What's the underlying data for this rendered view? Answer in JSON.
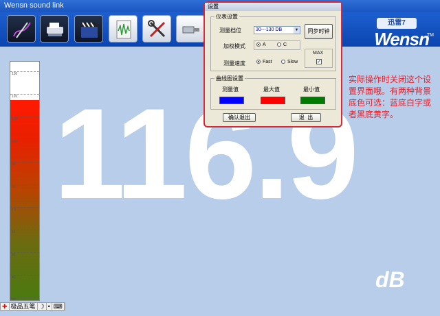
{
  "window": {
    "title": "Wensn sound link"
  },
  "toolbar": {
    "buttons": [
      {
        "icon": "graph-pen-icon"
      },
      {
        "icon": "scanner-icon"
      },
      {
        "icon": "clapperboard-icon"
      },
      {
        "icon": "waveform-document-icon"
      },
      {
        "icon": "tools-icon"
      },
      {
        "icon": "usb-cable-icon"
      }
    ]
  },
  "brand": {
    "badge": "迅雷7",
    "logo": "Wensn",
    "trademark": "TM"
  },
  "meter": {
    "level_percent": 84,
    "tick_labels": [
      "130",
      "120",
      "110",
      "100",
      "90",
      "80",
      "70",
      "60",
      "50",
      "40",
      "30"
    ]
  },
  "reading": {
    "value": "116.9",
    "unit": "dB"
  },
  "note": {
    "text": "实际操作时关闭这个设置界面哦。有两种背景底色可选：蓝底白字或者黑底黄字。"
  },
  "dialog": {
    "title": "设置",
    "meter_group": {
      "label": "仪表设置",
      "range_label": "测量档位",
      "range_value": "30---130 DB",
      "weighting_label": "加权模式",
      "weighting_options": [
        "A",
        "C"
      ],
      "weighting_selected": "A",
      "speed_label": "测量速度",
      "speed_options": [
        "Fast",
        "Slow"
      ],
      "speed_selected": "Fast",
      "sync_button": "同步时钟",
      "max_label": "MAX",
      "max_checked": true
    },
    "curve_group": {
      "label": "曲线图设置",
      "measured_label": "测量值",
      "max_label": "最大值",
      "min_label": "最小值",
      "measured_color": "#0000ff",
      "max_color": "#ff0000",
      "min_color": "#007a00"
    },
    "confirm_button": "确认退出",
    "exit_button": "退  出"
  },
  "ime": {
    "mode": "极品五笔",
    "moon": "☽",
    "dot": "•",
    "keyboard": "⌨"
  }
}
